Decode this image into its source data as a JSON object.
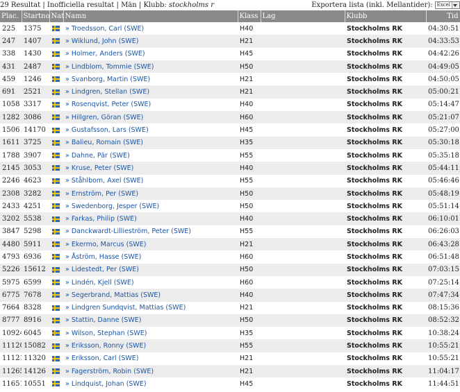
{
  "header": {
    "count_text": "29 Resultat",
    "status_text": "Inofficiella resultat",
    "category": "Män",
    "club_label": "Klubb:",
    "club_value": "stockholms r",
    "export_label": "Exportera lista (inkl. Mellantider):",
    "export_format": "Excel",
    "sep": "|"
  },
  "columns": {
    "plac": "Plac.",
    "startno": "Startno",
    "nat": "Nat",
    "namn": "Namn",
    "klass": "Klass",
    "lag": "Lag",
    "klubb": "Klubb",
    "tid": "Tid"
  },
  "flag_icon": "sweden-flag-icon",
  "rows": [
    {
      "plac": "225",
      "startno": "1375",
      "namn": "» Troedsson, Carl (SWE)",
      "klass": "H40",
      "lag": "",
      "klubb": "Stockholms RK",
      "tid": "04:30:51"
    },
    {
      "plac": "247",
      "startno": "1407",
      "namn": "» Wiklund, John (SWE)",
      "klass": "H21",
      "lag": "",
      "klubb": "Stockholms RK",
      "tid": "04:33:53"
    },
    {
      "plac": "338",
      "startno": "1430",
      "namn": "» Holmer, Anders (SWE)",
      "klass": "H45",
      "lag": "",
      "klubb": "Stockholms RK",
      "tid": "04:42:26"
    },
    {
      "plac": "431",
      "startno": "2487",
      "namn": "» Lindblom, Tommie (SWE)",
      "klass": "H50",
      "lag": "",
      "klubb": "Stockholms RK",
      "tid": "04:49:05"
    },
    {
      "plac": "459",
      "startno": "1246",
      "namn": "» Svanborg, Martin (SWE)",
      "klass": "H21",
      "lag": "",
      "klubb": "Stockholms RK",
      "tid": "04:50:05"
    },
    {
      "plac": "691",
      "startno": "2521",
      "namn": "» Lindgren, Stellan (SWE)",
      "klass": "H21",
      "lag": "",
      "klubb": "Stockholms RK",
      "tid": "05:00:21"
    },
    {
      "plac": "1058",
      "startno": "3317",
      "namn": "» Rosenqvist, Peter (SWE)",
      "klass": "H40",
      "lag": "",
      "klubb": "Stockholms RK",
      "tid": "05:14:47"
    },
    {
      "plac": "1282",
      "startno": "3086",
      "namn": "» Hillgren, Göran (SWE)",
      "klass": "H60",
      "lag": "",
      "klubb": "Stockholms RK",
      "tid": "05:21:07"
    },
    {
      "plac": "1506",
      "startno": "14170",
      "namn": "» Gustafsson, Lars (SWE)",
      "klass": "H45",
      "lag": "",
      "klubb": "Stockholms RK",
      "tid": "05:27:00"
    },
    {
      "plac": "1611",
      "startno": "3725",
      "namn": "» Balieu, Romain (SWE)",
      "klass": "H35",
      "lag": "",
      "klubb": "Stockholms RK",
      "tid": "05:30:18"
    },
    {
      "plac": "1788",
      "startno": "3907",
      "namn": "» Dahne, Pär (SWE)",
      "klass": "H55",
      "lag": "",
      "klubb": "Stockholms RK",
      "tid": "05:35:18"
    },
    {
      "plac": "2145",
      "startno": "3053",
      "namn": "» Kruse, Peter (SWE)",
      "klass": "H40",
      "lag": "",
      "klubb": "Stockholms RK",
      "tid": "05:44:11"
    },
    {
      "plac": "2246",
      "startno": "4623",
      "namn": "» Ståhlbom, Axel (SWE)",
      "klass": "H55",
      "lag": "",
      "klubb": "Stockholms RK",
      "tid": "05:46:46"
    },
    {
      "plac": "2308",
      "startno": "3282",
      "namn": "» Ernström, Per (SWE)",
      "klass": "H50",
      "lag": "",
      "klubb": "Stockholms RK",
      "tid": "05:48:19"
    },
    {
      "plac": "2433",
      "startno": "4251",
      "namn": "» Swedenborg, Jesper (SWE)",
      "klass": "H50",
      "lag": "",
      "klubb": "Stockholms RK",
      "tid": "05:51:14"
    },
    {
      "plac": "3202",
      "startno": "5538",
      "namn": "» Farkas, Philip (SWE)",
      "klass": "H40",
      "lag": "",
      "klubb": "Stockholms RK",
      "tid": "06:10:01"
    },
    {
      "plac": "3847",
      "startno": "5298",
      "namn": "» Danckwardt-Lillieström, Peter (SWE)",
      "klass": "H55",
      "lag": "",
      "klubb": "Stockholms RK",
      "tid": "06:26:03"
    },
    {
      "plac": "4480",
      "startno": "5911",
      "namn": "» Ekermo, Marcus (SWE)",
      "klass": "H21",
      "lag": "",
      "klubb": "Stockholms RK",
      "tid": "06:43:28"
    },
    {
      "plac": "4793",
      "startno": "6936",
      "namn": "» Åström, Hasse (SWE)",
      "klass": "H60",
      "lag": "",
      "klubb": "Stockholms RK",
      "tid": "06:51:48"
    },
    {
      "plac": "5226",
      "startno": "15612",
      "namn": "» Lidestedt, Per (SWE)",
      "klass": "H50",
      "lag": "",
      "klubb": "Stockholms RK",
      "tid": "07:03:15"
    },
    {
      "plac": "5975",
      "startno": "6599",
      "namn": "» Lindén, Kjell (SWE)",
      "klass": "H60",
      "lag": "",
      "klubb": "Stockholms RK",
      "tid": "07:25:14"
    },
    {
      "plac": "6775",
      "startno": "7678",
      "namn": "» Segerbrand, Mattias (SWE)",
      "klass": "H40",
      "lag": "",
      "klubb": "Stockholms RK",
      "tid": "07:47:34"
    },
    {
      "plac": "7664",
      "startno": "8328",
      "namn": "» Lindgren Sundqvist, Mattias (SWE)",
      "klass": "H21",
      "lag": "",
      "klubb": "Stockholms RK",
      "tid": "08:15:36"
    },
    {
      "plac": "8777",
      "startno": "8916",
      "namn": "» Stattin, Danne (SWE)",
      "klass": "H50",
      "lag": "",
      "klubb": "Stockholms RK",
      "tid": "08:52:32"
    },
    {
      "plac": "10924",
      "startno": "6045",
      "namn": "» Wilson, Stephan (SWE)",
      "klass": "H35",
      "lag": "",
      "klubb": "Stockholms RK",
      "tid": "10:38:24"
    },
    {
      "plac": "11120",
      "startno": "15082",
      "namn": "» Eriksson, Ronny (SWE)",
      "klass": "H55",
      "lag": "",
      "klubb": "Stockholms RK",
      "tid": "10:55:21"
    },
    {
      "plac": "11121",
      "startno": "11320",
      "namn": "» Eriksson, Carl (SWE)",
      "klass": "H21",
      "lag": "",
      "klubb": "Stockholms RK",
      "tid": "10:55:21"
    },
    {
      "plac": "11265",
      "startno": "14126",
      "namn": "» Fagerström, Robin (SWE)",
      "klass": "H21",
      "lag": "",
      "klubb": "Stockholms RK",
      "tid": "11:04:17"
    },
    {
      "plac": "11651",
      "startno": "10551",
      "namn": "» Lindquist, Johan (SWE)",
      "klass": "H45",
      "lag": "",
      "klubb": "Stockholms RK",
      "tid": "11:44:51"
    }
  ]
}
